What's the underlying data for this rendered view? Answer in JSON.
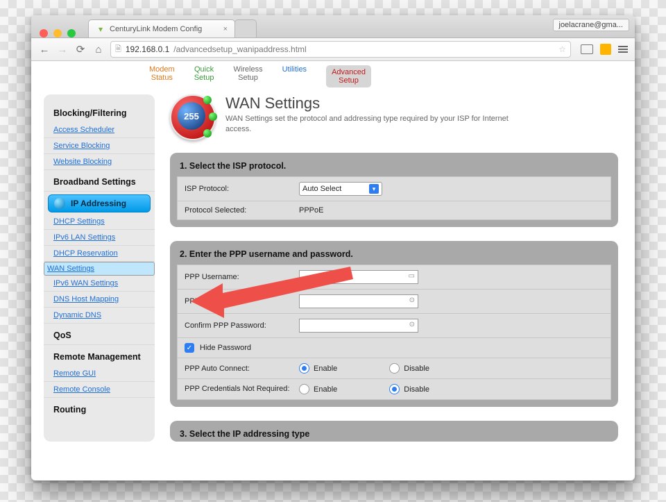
{
  "chrome": {
    "tab_title": "CenturyLink Modem Config",
    "profile": "joelacrane@gma...",
    "url_host": "192.168.0.1",
    "url_path": "/advancedsetup_wanipaddress.html"
  },
  "topnav": {
    "modem_status": "Modem\nStatus",
    "quick_setup": "Quick\nSetup",
    "wireless_setup": "Wireless\nSetup",
    "utilities": "Utilities",
    "advanced_setup": "Advanced\nSetup"
  },
  "sidebar": {
    "blocking_head": "Blocking/Filtering",
    "blocking": [
      "Access Scheduler",
      "Service Blocking",
      "Website Blocking"
    ],
    "broadband_head": "Broadband Settings",
    "ip_head": "IP Addressing",
    "ip": [
      "DHCP Settings",
      "IPv6 LAN Settings",
      "DHCP Reservation",
      "WAN Settings",
      "IPv6 WAN Settings",
      "DNS Host Mapping",
      "Dynamic DNS"
    ],
    "qos_head": "QoS",
    "remote_head": "Remote Management",
    "remote": [
      "Remote GUI",
      "Remote Console"
    ],
    "routing_head": "Routing"
  },
  "page": {
    "title": "WAN Settings",
    "subtitle": "WAN Settings set the protocol and addressing type required by your ISP for Internet access.",
    "icon_num": "255"
  },
  "panel1": {
    "head": "1. Select the ISP protocol.",
    "isp_label": "ISP Protocol:",
    "isp_value": "Auto Select",
    "sel_label": "Protocol Selected:",
    "sel_value": "PPPoE"
  },
  "panel2": {
    "head": "2. Enter the PPP username and password.",
    "user_label": "PPP Username:",
    "pass_label": "PPP Password:",
    "conf_label": "Confirm PPP Password:",
    "hide_label": "Hide Password",
    "auto_label": "PPP Auto Connect:",
    "cred_label": "PPP Credentials Not Required:",
    "enable": "Enable",
    "disable": "Disable"
  },
  "panel3": {
    "head": "3. Select the IP addressing type."
  }
}
